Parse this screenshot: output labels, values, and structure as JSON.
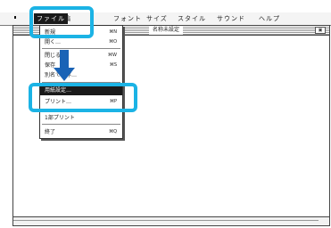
{
  "menubar": {
    "items": [
      {
        "label": "ファイル",
        "active": true
      },
      {
        "label": "編"
      },
      {
        "label": "フォント"
      },
      {
        "label": "サイズ"
      },
      {
        "label": "スタイル"
      },
      {
        "label": "サウンド"
      },
      {
        "label": "ヘルプ"
      }
    ]
  },
  "window": {
    "title": "名称未設定",
    "zoom_glyph": "▣"
  },
  "file_menu": {
    "items": [
      {
        "label": "新規",
        "shortcut": "⌘N"
      },
      {
        "label": "開く…",
        "shortcut": "⌘O"
      },
      {
        "label": "閉じる",
        "shortcut": "⌘W"
      },
      {
        "label": "保存",
        "shortcut": "⌘S"
      },
      {
        "label": "別名で保存…",
        "shortcut": ""
      },
      {
        "label": "用紙設定…",
        "shortcut": "",
        "selected": true
      },
      {
        "label": "プリント…",
        "shortcut": "⌘P"
      },
      {
        "label": "1部プリント",
        "shortcut": ""
      },
      {
        "label": "終了",
        "shortcut": "⌘Q"
      }
    ]
  },
  "colors": {
    "callout": "#1bb3e5",
    "arrow": "#1a63b6"
  }
}
